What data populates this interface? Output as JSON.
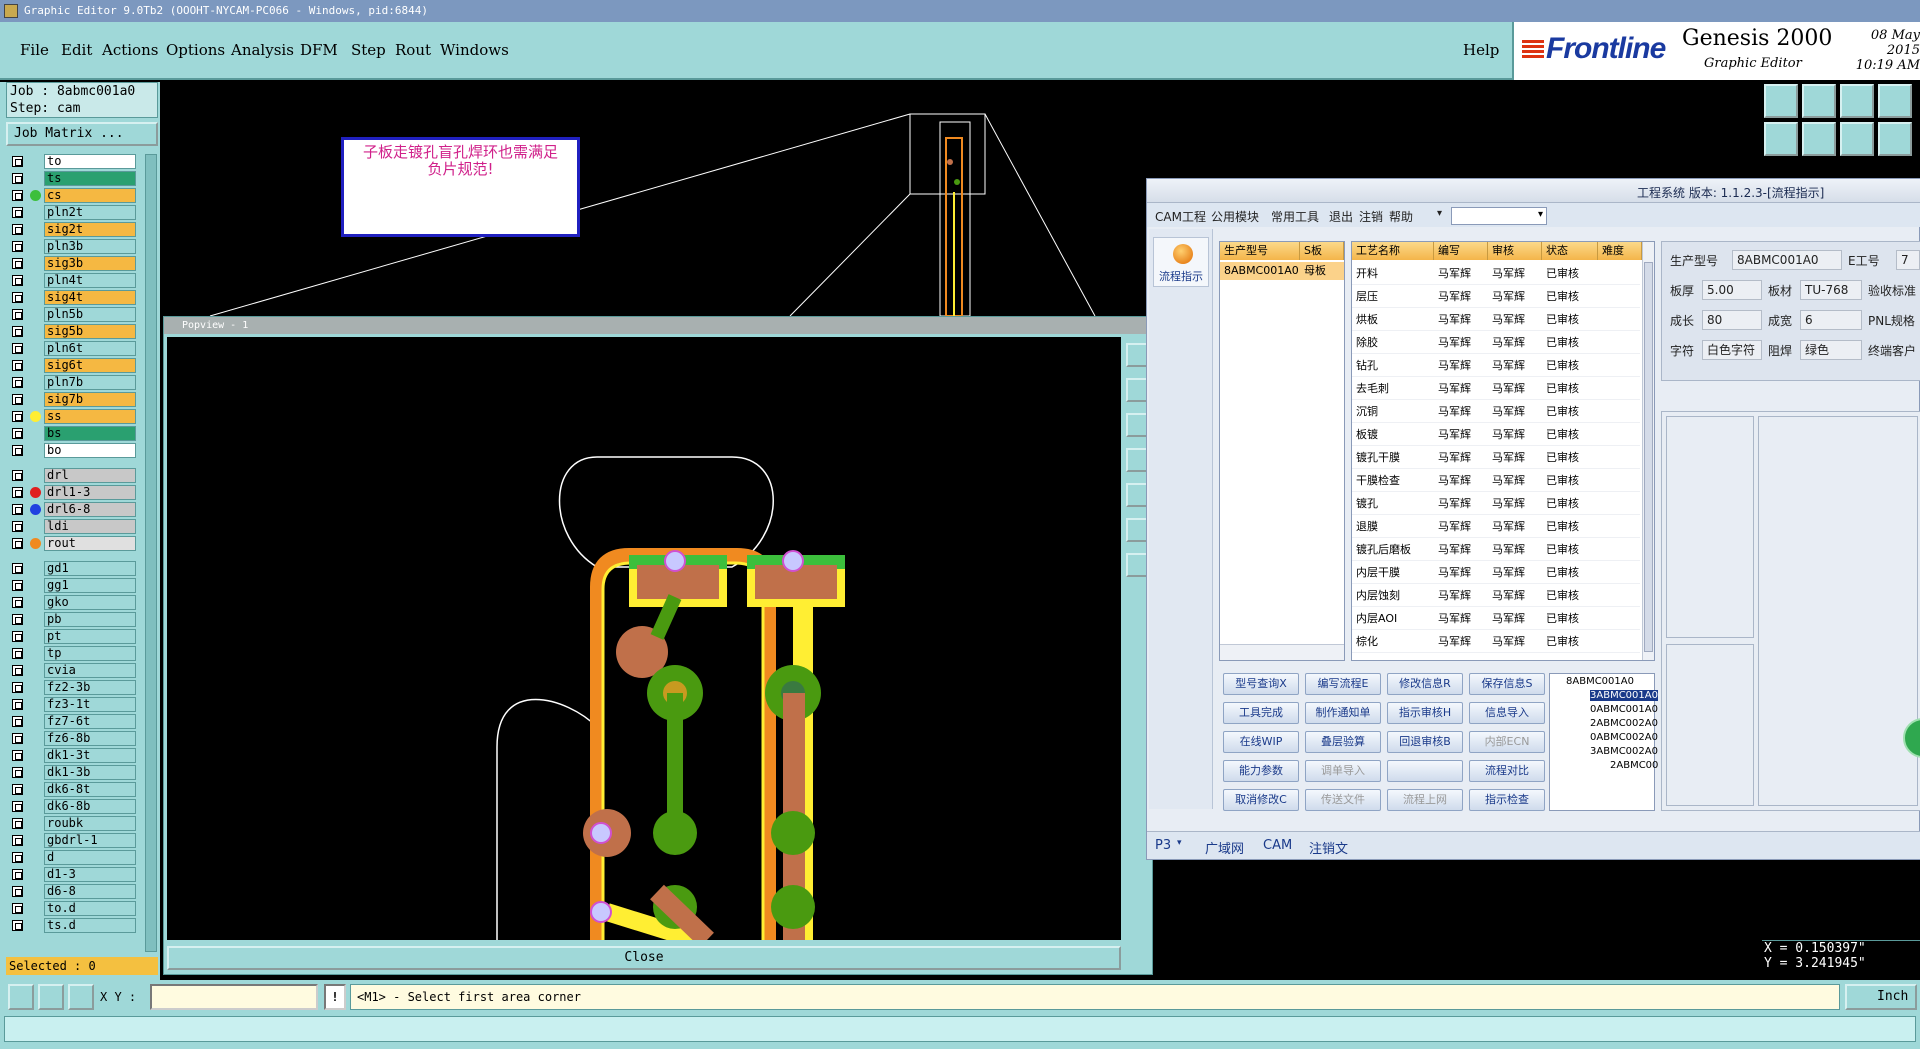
{
  "window": {
    "title": "Graphic Editor 9.0Tb2 (OOOHT-NYCAM-PC066 - Windows, pid:6844)"
  },
  "menu": {
    "items": [
      "File",
      "Edit",
      "Actions",
      "Options",
      "Analysis",
      "DFM",
      "Step",
      "Rout",
      "Windows"
    ],
    "help": "Help"
  },
  "brand": {
    "company": "Frontline",
    "product": "Genesis 2000",
    "subtitle": "Graphic Editor",
    "date": "08 May 2015",
    "time": "10:19 AM"
  },
  "job": {
    "job_line": "Job : 8abmc001a0",
    "step_line": "Step: cam",
    "matrix_button": "Job Matrix ..."
  },
  "layers": [
    {
      "name": "to",
      "color": "#ffffff",
      "dot": ""
    },
    {
      "name": "ts",
      "color": "#2aa070",
      "dot": ""
    },
    {
      "name": "cs",
      "color": "#f5b842",
      "dot": "#3cbf3c"
    },
    {
      "name": "pln2t",
      "color": "#9fd8d8",
      "dot": ""
    },
    {
      "name": "sig2t",
      "color": "#f5b842",
      "dot": ""
    },
    {
      "name": "pln3b",
      "color": "#9fd8d8",
      "dot": ""
    },
    {
      "name": "sig3b",
      "color": "#f5b842",
      "dot": ""
    },
    {
      "name": "pln4t",
      "color": "#9fd8d8",
      "dot": ""
    },
    {
      "name": "sig4t",
      "color": "#f5b842",
      "dot": ""
    },
    {
      "name": "pln5b",
      "color": "#9fd8d8",
      "dot": ""
    },
    {
      "name": "sig5b",
      "color": "#f5b842",
      "dot": ""
    },
    {
      "name": "pln6t",
      "color": "#9fd8d8",
      "dot": ""
    },
    {
      "name": "sig6t",
      "color": "#f5b842",
      "dot": ""
    },
    {
      "name": "pln7b",
      "color": "#9fd8d8",
      "dot": ""
    },
    {
      "name": "sig7b",
      "color": "#f5b842",
      "dot": ""
    },
    {
      "name": "ss",
      "color": "#f5b842",
      "dot": "#ffee33"
    },
    {
      "name": "bs",
      "color": "#2aa070",
      "dot": ""
    },
    {
      "name": "bo",
      "color": "#ffffff",
      "dot": ""
    },
    {
      "name": "drl",
      "color": "#c8c8c8",
      "dot": ""
    },
    {
      "name": "drl1-3",
      "color": "#c8c8c8",
      "dot": "#e02020"
    },
    {
      "name": "drl6-8",
      "color": "#c8c8c8",
      "dot": "#2040e0"
    },
    {
      "name": "ldi",
      "color": "#c8c8c8",
      "dot": ""
    },
    {
      "name": "rout",
      "color": "#e0e0e0",
      "dot": "#f08a20"
    },
    {
      "name": "gd1",
      "color": "#9fd8d8",
      "dot": ""
    },
    {
      "name": "gg1",
      "color": "#9fd8d8",
      "dot": ""
    },
    {
      "name": "gko",
      "color": "#9fd8d8",
      "dot": ""
    },
    {
      "name": "pb",
      "color": "#9fd8d8",
      "dot": ""
    },
    {
      "name": "pt",
      "color": "#9fd8d8",
      "dot": ""
    },
    {
      "name": "tp",
      "color": "#9fd8d8",
      "dot": ""
    },
    {
      "name": "cvia",
      "color": "#9fd8d8",
      "dot": ""
    },
    {
      "name": "fz2-3b",
      "color": "#9fd8d8",
      "dot": ""
    },
    {
      "name": "fz3-1t",
      "color": "#9fd8d8",
      "dot": ""
    },
    {
      "name": "fz7-6t",
      "color": "#9fd8d8",
      "dot": ""
    },
    {
      "name": "fz6-8b",
      "color": "#9fd8d8",
      "dot": ""
    },
    {
      "name": "dk1-3t",
      "color": "#9fd8d8",
      "dot": ""
    },
    {
      "name": "dk1-3b",
      "color": "#9fd8d8",
      "dot": ""
    },
    {
      "name": "dk6-8t",
      "color": "#9fd8d8",
      "dot": ""
    },
    {
      "name": "dk6-8b",
      "color": "#9fd8d8",
      "dot": ""
    },
    {
      "name": "roubk",
      "color": "#9fd8d8",
      "dot": ""
    },
    {
      "name": "gbdrl-1",
      "color": "#9fd8d8",
      "dot": ""
    },
    {
      "name": "d",
      "color": "#9fd8d8",
      "dot": ""
    },
    {
      "name": "d1-3",
      "color": "#9fd8d8",
      "dot": ""
    },
    {
      "name": "d6-8",
      "color": "#9fd8d8",
      "dot": ""
    },
    {
      "name": "to.d",
      "color": "#9fd8d8",
      "dot": ""
    },
    {
      "name": "ts.d",
      "color": "#9fd8d8",
      "dot": ""
    }
  ],
  "selected": "Selected : 0",
  "callout": {
    "line1": "子板走镀孔盲孔焊环也需满足",
    "line2": "负片规范!"
  },
  "popview": {
    "title": "Popview - 1",
    "close": "Close"
  },
  "coords": {
    "x": "X = 0.150397\"",
    "y": "Y = 3.241945\""
  },
  "bottom": {
    "xy_label": "X Y :",
    "xy_value": "",
    "bang": "!",
    "prompt": "<M1> - Select first area corner",
    "units": "Inch"
  },
  "proj": {
    "title": "工程系统 版本: 1.1.2.3-[流程指示]",
    "menu": [
      "CAM工程",
      "公用模块",
      "常用工具",
      "退出",
      "注销",
      "帮助"
    ],
    "flow_button": "流程指示",
    "prod_headers": [
      "生产型号",
      "S板"
    ],
    "prod_row": [
      "8ABMC001A0",
      "母板"
    ],
    "proc_headers": [
      "工艺名称",
      "编写",
      "审核",
      "状态",
      "难度"
    ],
    "proc_rows": [
      [
        "开料",
        "马军辉",
        "马军辉",
        "已审核"
      ],
      [
        "层压",
        "马军辉",
        "马军辉",
        "已审核"
      ],
      [
        "烘板",
        "马军辉",
        "马军辉",
        "已审核"
      ],
      [
        "除胶",
        "马军辉",
        "马军辉",
        "已审核"
      ],
      [
        "钻孔",
        "马军辉",
        "马军辉",
        "已审核"
      ],
      [
        "去毛刺",
        "马军辉",
        "马军辉",
        "已审核"
      ],
      [
        "沉铜",
        "马军辉",
        "马军辉",
        "已审核"
      ],
      [
        "板镀",
        "马军辉",
        "马军辉",
        "已审核"
      ],
      [
        "镀孔干膜",
        "马军辉",
        "马军辉",
        "已审核"
      ],
      [
        "干膜检查",
        "马军辉",
        "马军辉",
        "已审核"
      ],
      [
        "镀孔",
        "马军辉",
        "马军辉",
        "已审核"
      ],
      [
        "退膜",
        "马军辉",
        "马军辉",
        "已审核"
      ],
      [
        "镀孔后磨板",
        "马军辉",
        "马军辉",
        "已审核"
      ],
      [
        "内层干膜",
        "马军辉",
        "马军辉",
        "已审核"
      ],
      [
        "内层蚀刻",
        "马军辉",
        "马军辉",
        "已审核"
      ],
      [
        "内层AOI",
        "马军辉",
        "马军辉",
        "已审核"
      ],
      [
        "棕化",
        "马军辉",
        "马军辉",
        "已审核"
      ]
    ],
    "form": {
      "prod_no_label": "生产型号",
      "prod_no": "8ABMC001A0",
      "e_label": "E工号",
      "e_value": "7",
      "thick_label": "板厚",
      "thick": "5.00",
      "mat_label": "板材",
      "mat": "TU-768",
      "std_label": "验收标准",
      "len_label": "成长",
      "len": "80",
      "wid_label": "成宽",
      "wid": "6",
      "pnl_label": "PNL规格",
      "char_label": "字符",
      "char": "白色字符",
      "mask_label": "阻焊",
      "mask": "绿色",
      "cust_label": "终端客户"
    },
    "buttons": [
      {
        "label": "型号查询X",
        "dis": false
      },
      {
        "label": "编写流程E",
        "dis": false
      },
      {
        "label": "修改信息R",
        "dis": false
      },
      {
        "label": "保存信息S",
        "dis": false
      },
      {
        "label": "工具完成",
        "dis": false
      },
      {
        "label": "制作通知单",
        "dis": false
      },
      {
        "label": "指示审核H",
        "dis": false
      },
      {
        "label": "信息导入",
        "dis": false
      },
      {
        "label": "在线WIP",
        "dis": false
      },
      {
        "label": "叠层验算",
        "dis": false
      },
      {
        "label": "回退审核B",
        "dis": false
      },
      {
        "label": "内部ECN",
        "dis": true
      },
      {
        "label": "能力参数",
        "dis": false
      },
      {
        "label": "调单导入",
        "dis": true
      },
      {
        "label": "",
        "dis": false
      },
      {
        "label": "流程对比",
        "dis": false
      },
      {
        "label": "取消修改C",
        "dis": false
      },
      {
        "label": "传送文件",
        "dis": true
      },
      {
        "label": "流程上网",
        "dis": true
      },
      {
        "label": "指示检查",
        "dis": false
      }
    ],
    "tree": [
      "8ABMC001A0",
      "3ABMC001A0",
      "0ABMC001A0",
      "2ABMC002A0",
      "0ABMC002A0",
      "3ABMC002A0",
      "2ABMC00"
    ],
    "status": [
      "P3",
      "广域网",
      "CAM",
      "注销文"
    ]
  },
  "colors": {
    "accent": "#9fd8d8",
    "copper": "#c0704a",
    "trace": "#4a9a10",
    "outline": "#f08a20",
    "yellow": "#ffee33"
  }
}
